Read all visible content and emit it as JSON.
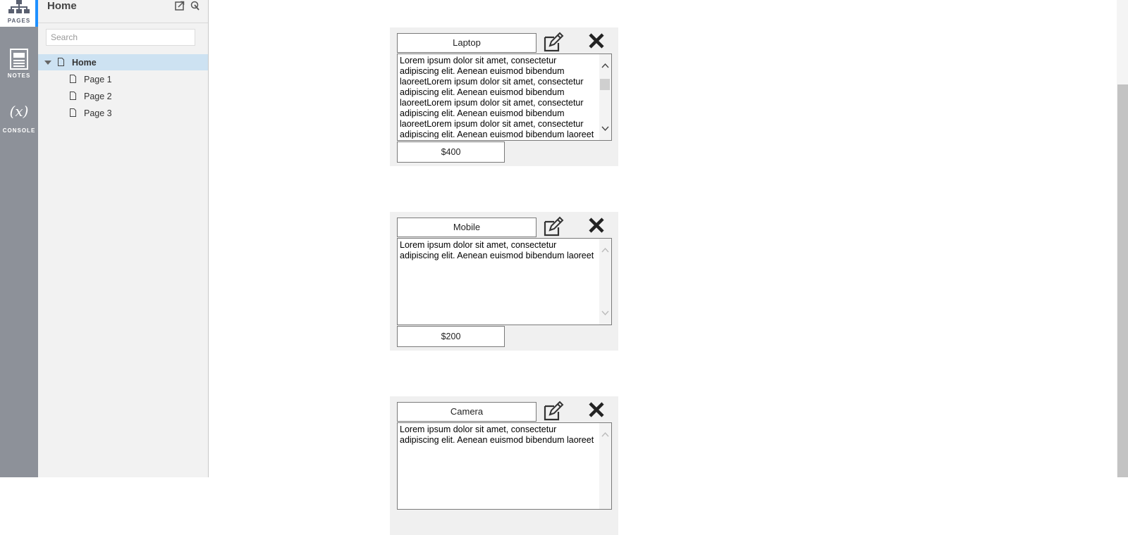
{
  "rail": {
    "items": [
      {
        "label": "PAGES",
        "icon": "sitemap-icon"
      },
      {
        "label": "NOTES",
        "icon": "notes-icon"
      },
      {
        "label": "CONSOLE",
        "icon": "variable-icon",
        "glyph": "(x)"
      }
    ]
  },
  "pages_panel": {
    "title": "Home",
    "search_placeholder": "Search",
    "tree": [
      {
        "label": "Home",
        "selected": true
      },
      {
        "label": "Page 1"
      },
      {
        "label": "Page 2"
      },
      {
        "label": "Page 3"
      }
    ]
  },
  "products": [
    {
      "name": "Laptop",
      "description": "Lorem ipsum dolor sit amet, consectetur adipiscing elit. Aenean euismod bibendum laoreetLorem ipsum dolor sit amet, consectetur adipiscing elit. Aenean euismod bibendum laoreetLorem ipsum dolor sit amet, consectetur adipiscing elit. Aenean euismod bibendum laoreetLorem ipsum dolor sit amet, consectetur adipiscing elit. Aenean euismod bibendum laoreet",
      "price": "$400"
    },
    {
      "name": "Mobile",
      "description": "Lorem ipsum dolor sit amet, consectetur adipiscing elit. Aenean euismod bibendum laoreet",
      "price": "$200"
    },
    {
      "name": "Camera",
      "description": "Lorem ipsum dolor sit amet, consectetur adipiscing elit. Aenean euismod bibendum laoreet",
      "price": ""
    }
  ],
  "colors": {
    "accent": "#1e90ff",
    "rail_bg": "#8d9199",
    "selected_row": "#cde2f2"
  }
}
